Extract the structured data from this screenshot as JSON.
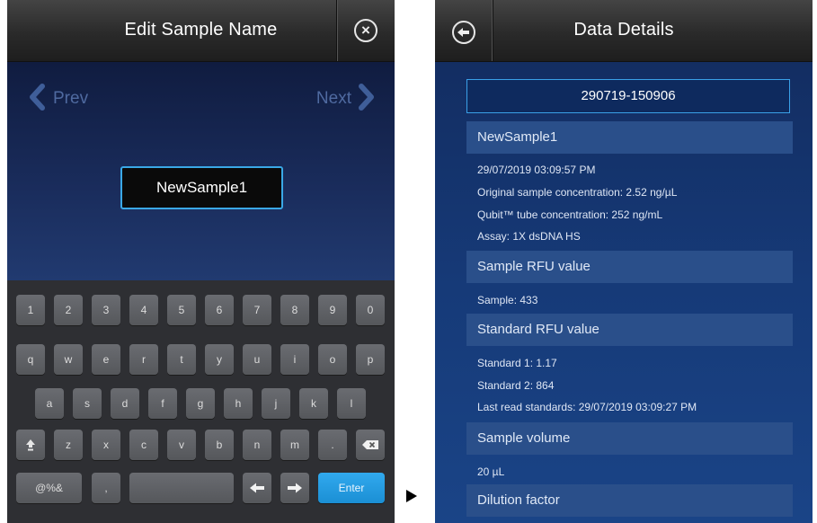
{
  "left": {
    "title": "Edit Sample Name",
    "prev_label": "Prev",
    "next_label": "Next",
    "sample_name": "NewSample1",
    "keyboard": {
      "row1": [
        "1",
        "2",
        "3",
        "4",
        "5",
        "6",
        "7",
        "8",
        "9",
        "0"
      ],
      "row2": [
        "q",
        "w",
        "e",
        "r",
        "t",
        "y",
        "u",
        "i",
        "o",
        "p"
      ],
      "row3": [
        "a",
        "s",
        "d",
        "f",
        "g",
        "h",
        "j",
        "k",
        "l"
      ],
      "row4_letters": [
        "z",
        "x",
        "c",
        "v",
        "b",
        "n",
        "m",
        "."
      ],
      "symbols_label": "@%&",
      "comma_label": ",",
      "enter_label": "Enter"
    }
  },
  "right": {
    "title": "Data Details",
    "run_id": "290719-150906",
    "sample_name": "NewSample1",
    "sample_info": [
      "29/07/2019 03:09:57 PM",
      "Original sample concentration: 2.52 ng/µL",
      "Qubit™ tube concentration: 252 ng/mL",
      "Assay: 1X dsDNA HS"
    ],
    "rfu_header": "Sample RFU value",
    "rfu_line": "Sample: 433",
    "std_header": "Standard RFU value",
    "std_lines": [
      "Standard 1: 1.17",
      "Standard 2: 864",
      "Last read standards: 29/07/2019 03:09:27 PM"
    ],
    "volume_header": "Sample volume",
    "volume_line": "20 µL",
    "dilution_header": "Dilution factor"
  },
  "icons": {
    "close": "close-circle-icon",
    "back": "back-arrow-circle-icon",
    "prev": "chevron-left-icon",
    "next": "chevron-right-icon",
    "shift": "shift-icon",
    "backspace": "backspace-icon",
    "left_arrow": "arrow-left-icon",
    "right_arrow": "arrow-right-icon",
    "play": "play-triangle-icon"
  },
  "colors": {
    "accent": "#31a9ee",
    "left_bg": "#1b2a55",
    "right_bg": "#163a78",
    "section_bg": "#2a4f8a"
  }
}
